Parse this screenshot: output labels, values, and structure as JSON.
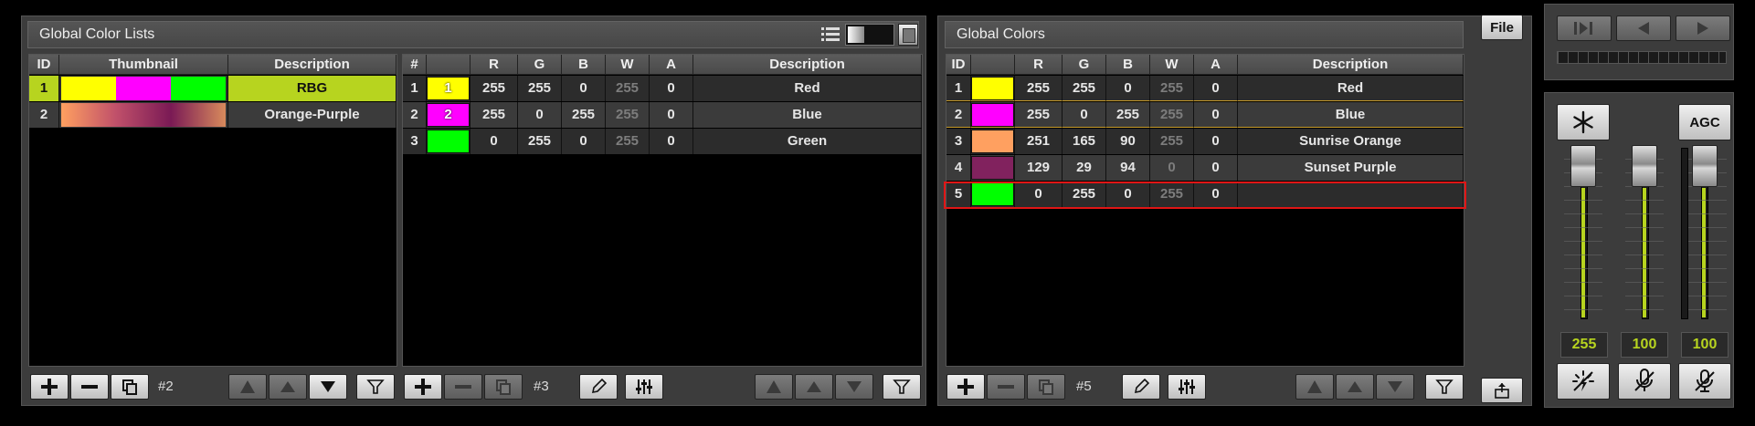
{
  "colors": {
    "accent": "#b7d41f",
    "selection_outline": "#e01515"
  },
  "left_panel": {
    "title": "Global Color Lists",
    "header": [
      "ID",
      "Thumbnail",
      "Description"
    ],
    "rows": [
      {
        "id": "1",
        "description": "RBG",
        "thumbnail": [
          "#ffff00",
          "#ff00ff",
          "#00ff00"
        ]
      },
      {
        "id": "2",
        "description": "Orange-Purple",
        "thumbnail_gradient": [
          "#ffa060",
          "#c0506a",
          "#7a1a55",
          "#d88a5c"
        ]
      }
    ],
    "count": "#2"
  },
  "middle_panel": {
    "header": [
      "#",
      "",
      "R",
      "G",
      "B",
      "W",
      "A",
      "Description"
    ],
    "rows": [
      {
        "num": "1",
        "swatch": "#ffff00",
        "label": "1",
        "r": "255",
        "g": "255",
        "b": "0",
        "w": "255",
        "a": "0",
        "description": "Red"
      },
      {
        "num": "2",
        "swatch": "#ff00ff",
        "label": "2",
        "r": "255",
        "g": "0",
        "b": "255",
        "w": "255",
        "a": "0",
        "description": "Blue"
      },
      {
        "num": "3",
        "swatch": "#00ff00",
        "label": "",
        "r": "0",
        "g": "255",
        "b": "0",
        "w": "255",
        "a": "0",
        "description": "Green"
      }
    ],
    "count": "#3"
  },
  "right_panel": {
    "title": "Global Colors",
    "header": [
      "ID",
      "",
      "R",
      "G",
      "B",
      "W",
      "A",
      "Description"
    ],
    "rows": [
      {
        "id": "1",
        "swatch": "#ffff00",
        "r": "255",
        "g": "255",
        "b": "0",
        "w": "255",
        "a": "0",
        "description": "Red"
      },
      {
        "id": "2",
        "swatch": "#ff00ff",
        "r": "255",
        "g": "0",
        "b": "255",
        "w": "255",
        "a": "0",
        "description": "Blue"
      },
      {
        "id": "3",
        "swatch": "#ffa060",
        "r": "251",
        "g": "165",
        "b": "90",
        "w": "255",
        "a": "0",
        "description": "Sunrise Orange"
      },
      {
        "id": "4",
        "swatch": "#81225e",
        "r": "129",
        "g": "29",
        "b": "94",
        "w": "0",
        "a": "0",
        "description": "Sunset Purple"
      },
      {
        "id": "5",
        "swatch": "#00ff00",
        "r": "0",
        "g": "255",
        "b": "0",
        "w": "255",
        "a": "0",
        "description": ""
      }
    ],
    "count": "#5"
  },
  "file_button": "File",
  "master": {
    "agc_label": "AGC",
    "faders": [
      {
        "value": "255",
        "level": 1.0
      },
      {
        "value": "100",
        "level": 1.0
      },
      {
        "value": "100",
        "level": 1.0
      }
    ]
  }
}
